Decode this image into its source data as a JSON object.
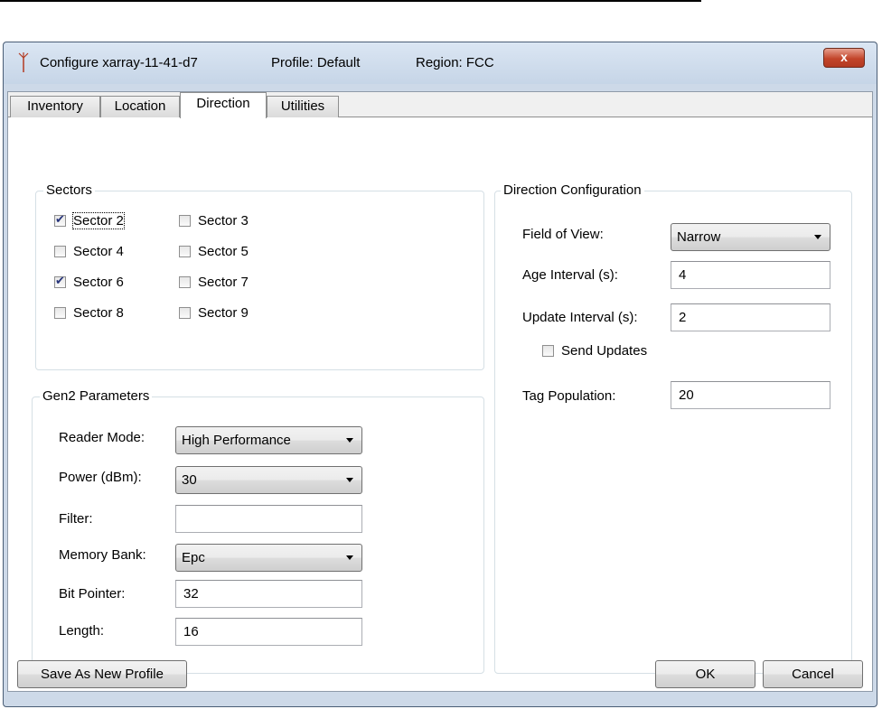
{
  "window": {
    "title": "Configure xarray-11-41-d7",
    "profile": "Profile: Default",
    "region": "Region: FCC",
    "close_label": "x"
  },
  "tabs": [
    {
      "label": "Inventory",
      "active": false
    },
    {
      "label": "Location",
      "active": false
    },
    {
      "label": "Direction",
      "active": true
    },
    {
      "label": "Utilities",
      "active": false
    }
  ],
  "sectors": {
    "title": "Sectors",
    "items": [
      {
        "label": "Sector 2",
        "checked": true
      },
      {
        "label": "Sector 3",
        "checked": false
      },
      {
        "label": "Sector 4",
        "checked": false
      },
      {
        "label": "Sector 5",
        "checked": false
      },
      {
        "label": "Sector 6",
        "checked": true
      },
      {
        "label": "Sector 7",
        "checked": false
      },
      {
        "label": "Sector 8",
        "checked": false
      },
      {
        "label": "Sector 9",
        "checked": false
      }
    ]
  },
  "gen2": {
    "title": "Gen2 Parameters",
    "reader_mode_label": "Reader Mode:",
    "reader_mode_value": "High Performance",
    "power_label": "Power (dBm):",
    "power_value": "30",
    "filter_label": "Filter:",
    "filter_value": "",
    "memory_bank_label": "Memory Bank:",
    "memory_bank_value": "Epc",
    "bit_pointer_label": "Bit Pointer:",
    "bit_pointer_value": "32",
    "length_label": "Length:",
    "length_value": "16"
  },
  "direction": {
    "title": "Direction Configuration",
    "fov_label": "Field of View:",
    "fov_value": "Narrow",
    "age_label": "Age Interval (s):",
    "age_value": "4",
    "update_label": "Update Interval (s):",
    "update_value": "2",
    "send_updates_label": "Send Updates",
    "send_updates_checked": false,
    "tag_pop_label": "Tag Population:",
    "tag_pop_value": "20"
  },
  "buttons": {
    "save_as_new": "Save As New Profile",
    "ok": "OK",
    "cancel": "Cancel"
  },
  "colors": {
    "close_button": "#c2452a",
    "check_mark": "#27347a",
    "frame": "#cdd9e8"
  }
}
